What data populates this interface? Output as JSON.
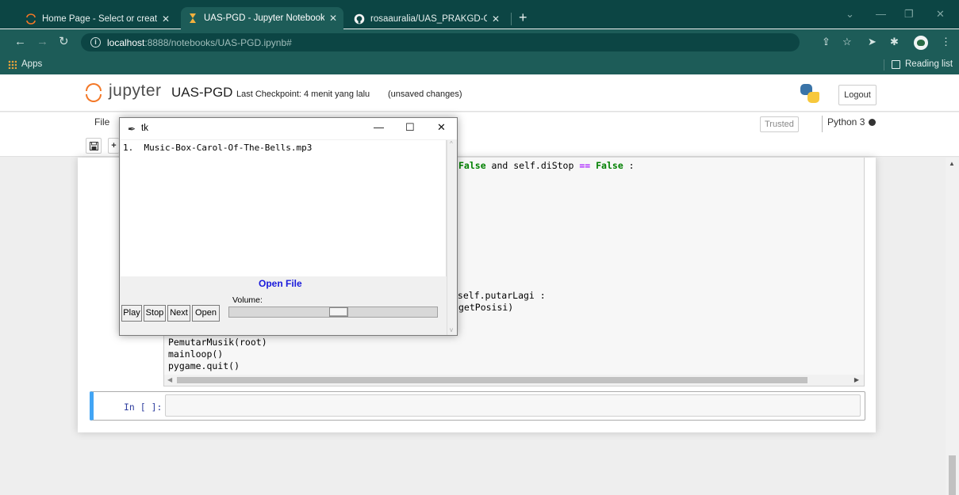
{
  "browser": {
    "tabs": [
      {
        "title": "Home Page - Select or create a n",
        "active": false
      },
      {
        "title": "UAS-PGD - Jupyter Notebook",
        "active": true
      },
      {
        "title": "rosaauralia/UAS_PRAKGD-GD",
        "active": false
      }
    ],
    "tab_close_glyph": "✕",
    "new_tab_glyph": "+",
    "url_host": "localhost",
    "url_path": ":8888/notebooks/UAS-PGD.ipynb#",
    "bookmarks": {
      "apps_label": "Apps",
      "reading_list_label": "Reading list"
    }
  },
  "jupyter": {
    "logo_text": "jupyter",
    "notebook_name": "UAS-PGD",
    "checkpoint": "Last Checkpoint: 4 menit yang lalu",
    "unsaved": "(unsaved changes)",
    "logout_label": "Logout",
    "menu_file": "File",
    "trusted_label": "Trusted",
    "kernel_name": "Python 3",
    "code_fragments": {
      "line1_kw1": "False",
      "line1_mid": " and self.diStop ",
      "line1_op": "==",
      "line1_kw2": "False",
      "line1_end": " :",
      "line2": " self.putarLagi :",
      "line3": "getPosisi)",
      "line4": "PemutarMusik(root)",
      "line5": "mainloop()",
      "line6": "pygame.quit()"
    },
    "prompt": "In [ ]:"
  },
  "tk_window": {
    "title": "tk",
    "playlist": [
      "1.  Music-Box-Carol-Of-The-Bells.mp3"
    ],
    "open_file_label": "Open File",
    "volume_label": "Volume:",
    "volume_level": 0.53,
    "buttons": {
      "play": "Play",
      "stop": "Stop",
      "next": "Next",
      "open": "Open"
    }
  },
  "colors": {
    "chrome_frame": "#0c4544",
    "chrome_toolbar": "#1d5c58",
    "jupyter_orange": "#f37726",
    "selected_cell": "#42a5f5",
    "open_file_blue": "#1a1adb"
  }
}
